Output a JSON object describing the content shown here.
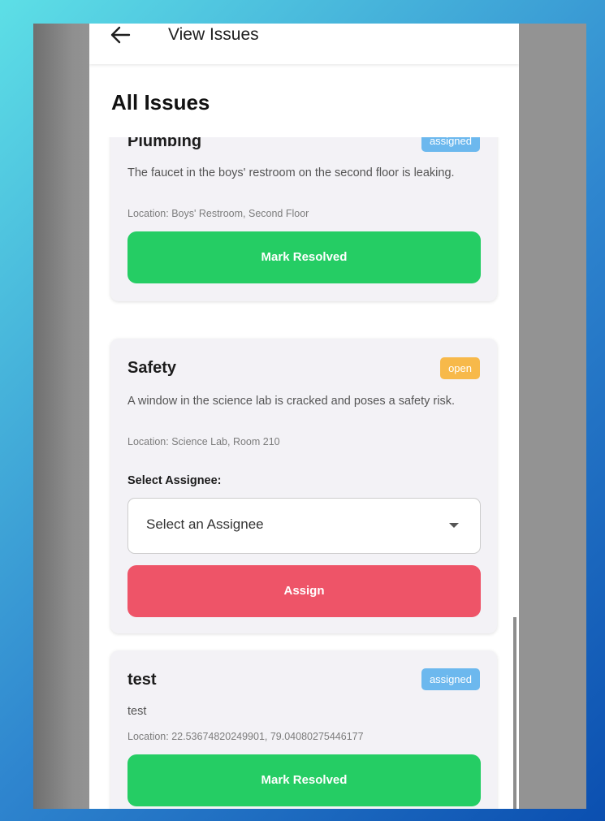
{
  "appbar": {
    "title": "View Issues",
    "back_icon": "arrow-left-icon"
  },
  "page": {
    "title": "All Issues"
  },
  "issues": [
    {
      "title": "Plumbing",
      "status": "assigned",
      "description": "The faucet in the boys' restroom on the second floor is leaking.",
      "location": "Location: Boys' Restroom, Second Floor",
      "action_label": "Mark Resolved"
    },
    {
      "title": "Safety",
      "status": "open",
      "description": "A window in the science lab is cracked and poses a safety risk.",
      "location": "Location: Science Lab, Room 210",
      "assignee_label": "Select Assignee:",
      "assignee_placeholder": "Select an Assignee",
      "action_label": "Assign"
    },
    {
      "title": "test",
      "status": "assigned",
      "description": "test",
      "location": "Location: 22.53674820249901, 79.04080275446177",
      "action_label": "Mark Resolved"
    }
  ],
  "colors": {
    "green_button": "#25cd64",
    "red_button": "#ee5468",
    "badge_assigned": "#6cb8ee",
    "badge_open": "#f7b94a"
  }
}
